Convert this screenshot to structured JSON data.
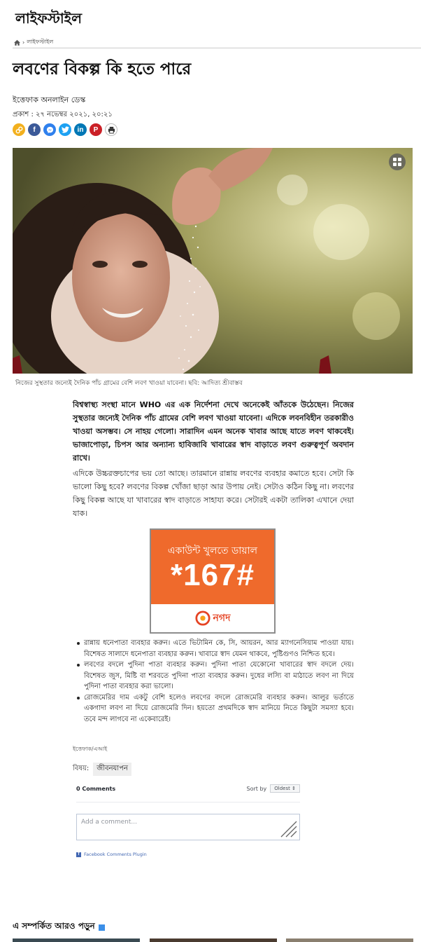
{
  "section": {
    "title": "লাইফস্টাইল"
  },
  "breadcrumb": {
    "separator": "›",
    "current": "লাইফস্টাইল"
  },
  "article": {
    "headline": "লবণের বিকল্প কি হতে পারে",
    "author": "ইত্তেফাক অনলাইন ডেস্ক",
    "published": "প্রকাশ : ২৭ নভেম্বর ২০২১, ২০:২১",
    "caption": "নিজের সুস্থতার জন্যেই দৈনিক পাঁচ গ্রামের বেশি লবণ খাওয়া যাবেনা। ছবি: আদিত্য শ্রীবাস্তব",
    "lead": "বিশ্বস্বাস্থ্য সংস্থা মানে WHO এর এক নির্দেশনা দেখে অনেকেই আঁতকে উঠেছেন। নিজের সুস্থতার জন্যেই দৈনিক পাঁচ গ্রামের বেশি লবণ খাওয়া যাবেনা। এদিকে লবনবিহীন তরকারীও খাওয়া অসম্ভব। সে নাহয় গেলো। সারাদিন এমন অনেক খাবার আছে যাতে লবণ থাকবেই। ভাজাপোড়া, চিপস আর অন্যান্য হাবিজাবি খাবারের স্বাদ বাড়াতে লবণ গুরুত্বপূর্ণ অবদান রাখে।",
    "paragraph": "এদিকে উচ্চরক্তচাপের ভয় তো আছে। তারমানে রান্নায় লবণের ব্যবহার কমাতে হবে। সেটা কি ভালো কিছু হবে? লবণের বিকল্প খোঁজা ছাড়া আর উপায় নেই। সেটাও কঠিন কিছু না। লবণের কিছু বিকল্প আছে যা খাবারের স্বাদ বাড়াতে সাহায্য করে। সেটারই একটা তালিকা এখানে দেয়া যাক।",
    "bullets": [
      "রান্নায় ধনেপাতা ব্যবহার করুন। এতে ভিটামিন কে, সি, আয়রন, আর ম্যাগনেসিয়াম পাওয়া যায়। বিশেষত সালাদে ধনেপাতা ব্যবহার করুন। খাবারে স্বাদ যেমন থাকবে, পুষ্টিগুণও নিশ্চিত হবে।",
      "লবণের বদলে পুদিনা পাতা ব্যবহার করুন। পুদিনা পাতা যেকোনো খাবারের স্বাদ বদলে দেয়। বিশেষত জুস, মিষ্টি বা শরবতে পুদিনা পাতা ব্যবহার করুন। দুধের লস্যি বা মাঠাতে লবণ না দিয়ে পুদিনা পাতা ব্যবহার করা ভালো।",
      "রোজমেরির দাম একটু বেশি হলেও লবণের বদলে রোজমেরি ব্যবহার করুন। আলুর ভর্তাতে একগাদা লবণ না দিয়ে রোজমেরি দিন। হয়তো প্রথমদিকে স্বাদ মানিয়ে নিতে কিছুটা সমস্যা হবে। তবে মন্দ লাগবে না একেবারেই।"
    ],
    "source": "ইত্তেফাক/এআই",
    "topic_label": "বিষয়:",
    "topic": "জীবনযাপন"
  },
  "share": {
    "icons": [
      "link-icon",
      "facebook-icon",
      "messenger-icon",
      "twitter-icon",
      "linkedin-icon",
      "pinterest-icon",
      "print-icon"
    ],
    "colors": [
      "#f2b01e",
      "#3b5998",
      "#2f80ed",
      "#1da1f2",
      "#0077b5",
      "#cb2027",
      "#777777"
    ]
  },
  "ad": {
    "headline": "একাউন্ট খুলতে ডায়াল",
    "code": "*167#",
    "brand": "নগদ",
    "background": "#ef6a2c"
  },
  "comments": {
    "count_label": "0 Comments",
    "sort_label": "Sort by",
    "sort_value": "Oldest",
    "placeholder": "Add a comment...",
    "plugin_label": "Facebook Comments Plugin"
  },
  "related": {
    "title": "এ সম্পর্কিত আরও পড়ুন",
    "accent": "#3b8fe8"
  }
}
